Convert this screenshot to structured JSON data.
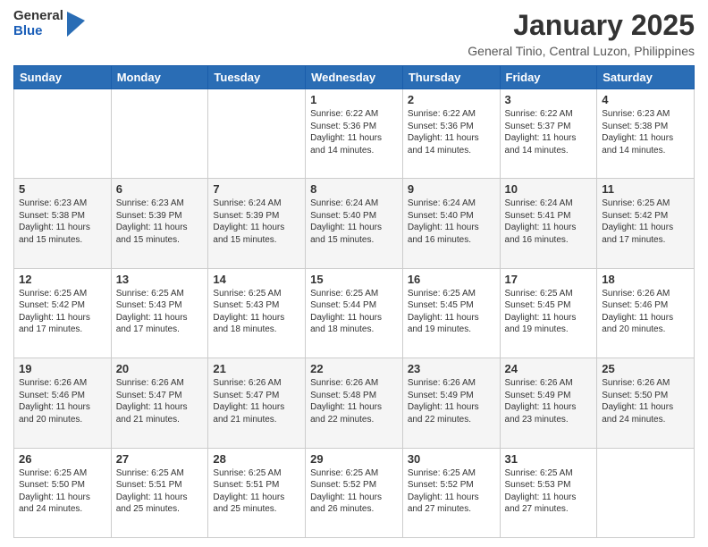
{
  "logo": {
    "general": "General",
    "blue": "Blue"
  },
  "header": {
    "title": "January 2025",
    "subtitle": "General Tinio, Central Luzon, Philippines"
  },
  "weekdays": [
    "Sunday",
    "Monday",
    "Tuesday",
    "Wednesday",
    "Thursday",
    "Friday",
    "Saturday"
  ],
  "weeks": [
    [
      {
        "day": "",
        "info": ""
      },
      {
        "day": "",
        "info": ""
      },
      {
        "day": "",
        "info": ""
      },
      {
        "day": "1",
        "info": "Sunrise: 6:22 AM\nSunset: 5:36 PM\nDaylight: 11 hours and 14 minutes."
      },
      {
        "day": "2",
        "info": "Sunrise: 6:22 AM\nSunset: 5:36 PM\nDaylight: 11 hours and 14 minutes."
      },
      {
        "day": "3",
        "info": "Sunrise: 6:22 AM\nSunset: 5:37 PM\nDaylight: 11 hours and 14 minutes."
      },
      {
        "day": "4",
        "info": "Sunrise: 6:23 AM\nSunset: 5:38 PM\nDaylight: 11 hours and 14 minutes."
      }
    ],
    [
      {
        "day": "5",
        "info": "Sunrise: 6:23 AM\nSunset: 5:38 PM\nDaylight: 11 hours and 15 minutes."
      },
      {
        "day": "6",
        "info": "Sunrise: 6:23 AM\nSunset: 5:39 PM\nDaylight: 11 hours and 15 minutes."
      },
      {
        "day": "7",
        "info": "Sunrise: 6:24 AM\nSunset: 5:39 PM\nDaylight: 11 hours and 15 minutes."
      },
      {
        "day": "8",
        "info": "Sunrise: 6:24 AM\nSunset: 5:40 PM\nDaylight: 11 hours and 15 minutes."
      },
      {
        "day": "9",
        "info": "Sunrise: 6:24 AM\nSunset: 5:40 PM\nDaylight: 11 hours and 16 minutes."
      },
      {
        "day": "10",
        "info": "Sunrise: 6:24 AM\nSunset: 5:41 PM\nDaylight: 11 hours and 16 minutes."
      },
      {
        "day": "11",
        "info": "Sunrise: 6:25 AM\nSunset: 5:42 PM\nDaylight: 11 hours and 17 minutes."
      }
    ],
    [
      {
        "day": "12",
        "info": "Sunrise: 6:25 AM\nSunset: 5:42 PM\nDaylight: 11 hours and 17 minutes."
      },
      {
        "day": "13",
        "info": "Sunrise: 6:25 AM\nSunset: 5:43 PM\nDaylight: 11 hours and 17 minutes."
      },
      {
        "day": "14",
        "info": "Sunrise: 6:25 AM\nSunset: 5:43 PM\nDaylight: 11 hours and 18 minutes."
      },
      {
        "day": "15",
        "info": "Sunrise: 6:25 AM\nSunset: 5:44 PM\nDaylight: 11 hours and 18 minutes."
      },
      {
        "day": "16",
        "info": "Sunrise: 6:25 AM\nSunset: 5:45 PM\nDaylight: 11 hours and 19 minutes."
      },
      {
        "day": "17",
        "info": "Sunrise: 6:25 AM\nSunset: 5:45 PM\nDaylight: 11 hours and 19 minutes."
      },
      {
        "day": "18",
        "info": "Sunrise: 6:26 AM\nSunset: 5:46 PM\nDaylight: 11 hours and 20 minutes."
      }
    ],
    [
      {
        "day": "19",
        "info": "Sunrise: 6:26 AM\nSunset: 5:46 PM\nDaylight: 11 hours and 20 minutes."
      },
      {
        "day": "20",
        "info": "Sunrise: 6:26 AM\nSunset: 5:47 PM\nDaylight: 11 hours and 21 minutes."
      },
      {
        "day": "21",
        "info": "Sunrise: 6:26 AM\nSunset: 5:47 PM\nDaylight: 11 hours and 21 minutes."
      },
      {
        "day": "22",
        "info": "Sunrise: 6:26 AM\nSunset: 5:48 PM\nDaylight: 11 hours and 22 minutes."
      },
      {
        "day": "23",
        "info": "Sunrise: 6:26 AM\nSunset: 5:49 PM\nDaylight: 11 hours and 22 minutes."
      },
      {
        "day": "24",
        "info": "Sunrise: 6:26 AM\nSunset: 5:49 PM\nDaylight: 11 hours and 23 minutes."
      },
      {
        "day": "25",
        "info": "Sunrise: 6:26 AM\nSunset: 5:50 PM\nDaylight: 11 hours and 24 minutes."
      }
    ],
    [
      {
        "day": "26",
        "info": "Sunrise: 6:25 AM\nSunset: 5:50 PM\nDaylight: 11 hours and 24 minutes."
      },
      {
        "day": "27",
        "info": "Sunrise: 6:25 AM\nSunset: 5:51 PM\nDaylight: 11 hours and 25 minutes."
      },
      {
        "day": "28",
        "info": "Sunrise: 6:25 AM\nSunset: 5:51 PM\nDaylight: 11 hours and 25 minutes."
      },
      {
        "day": "29",
        "info": "Sunrise: 6:25 AM\nSunset: 5:52 PM\nDaylight: 11 hours and 26 minutes."
      },
      {
        "day": "30",
        "info": "Sunrise: 6:25 AM\nSunset: 5:52 PM\nDaylight: 11 hours and 27 minutes."
      },
      {
        "day": "31",
        "info": "Sunrise: 6:25 AM\nSunset: 5:53 PM\nDaylight: 11 hours and 27 minutes."
      },
      {
        "day": "",
        "info": ""
      }
    ]
  ]
}
